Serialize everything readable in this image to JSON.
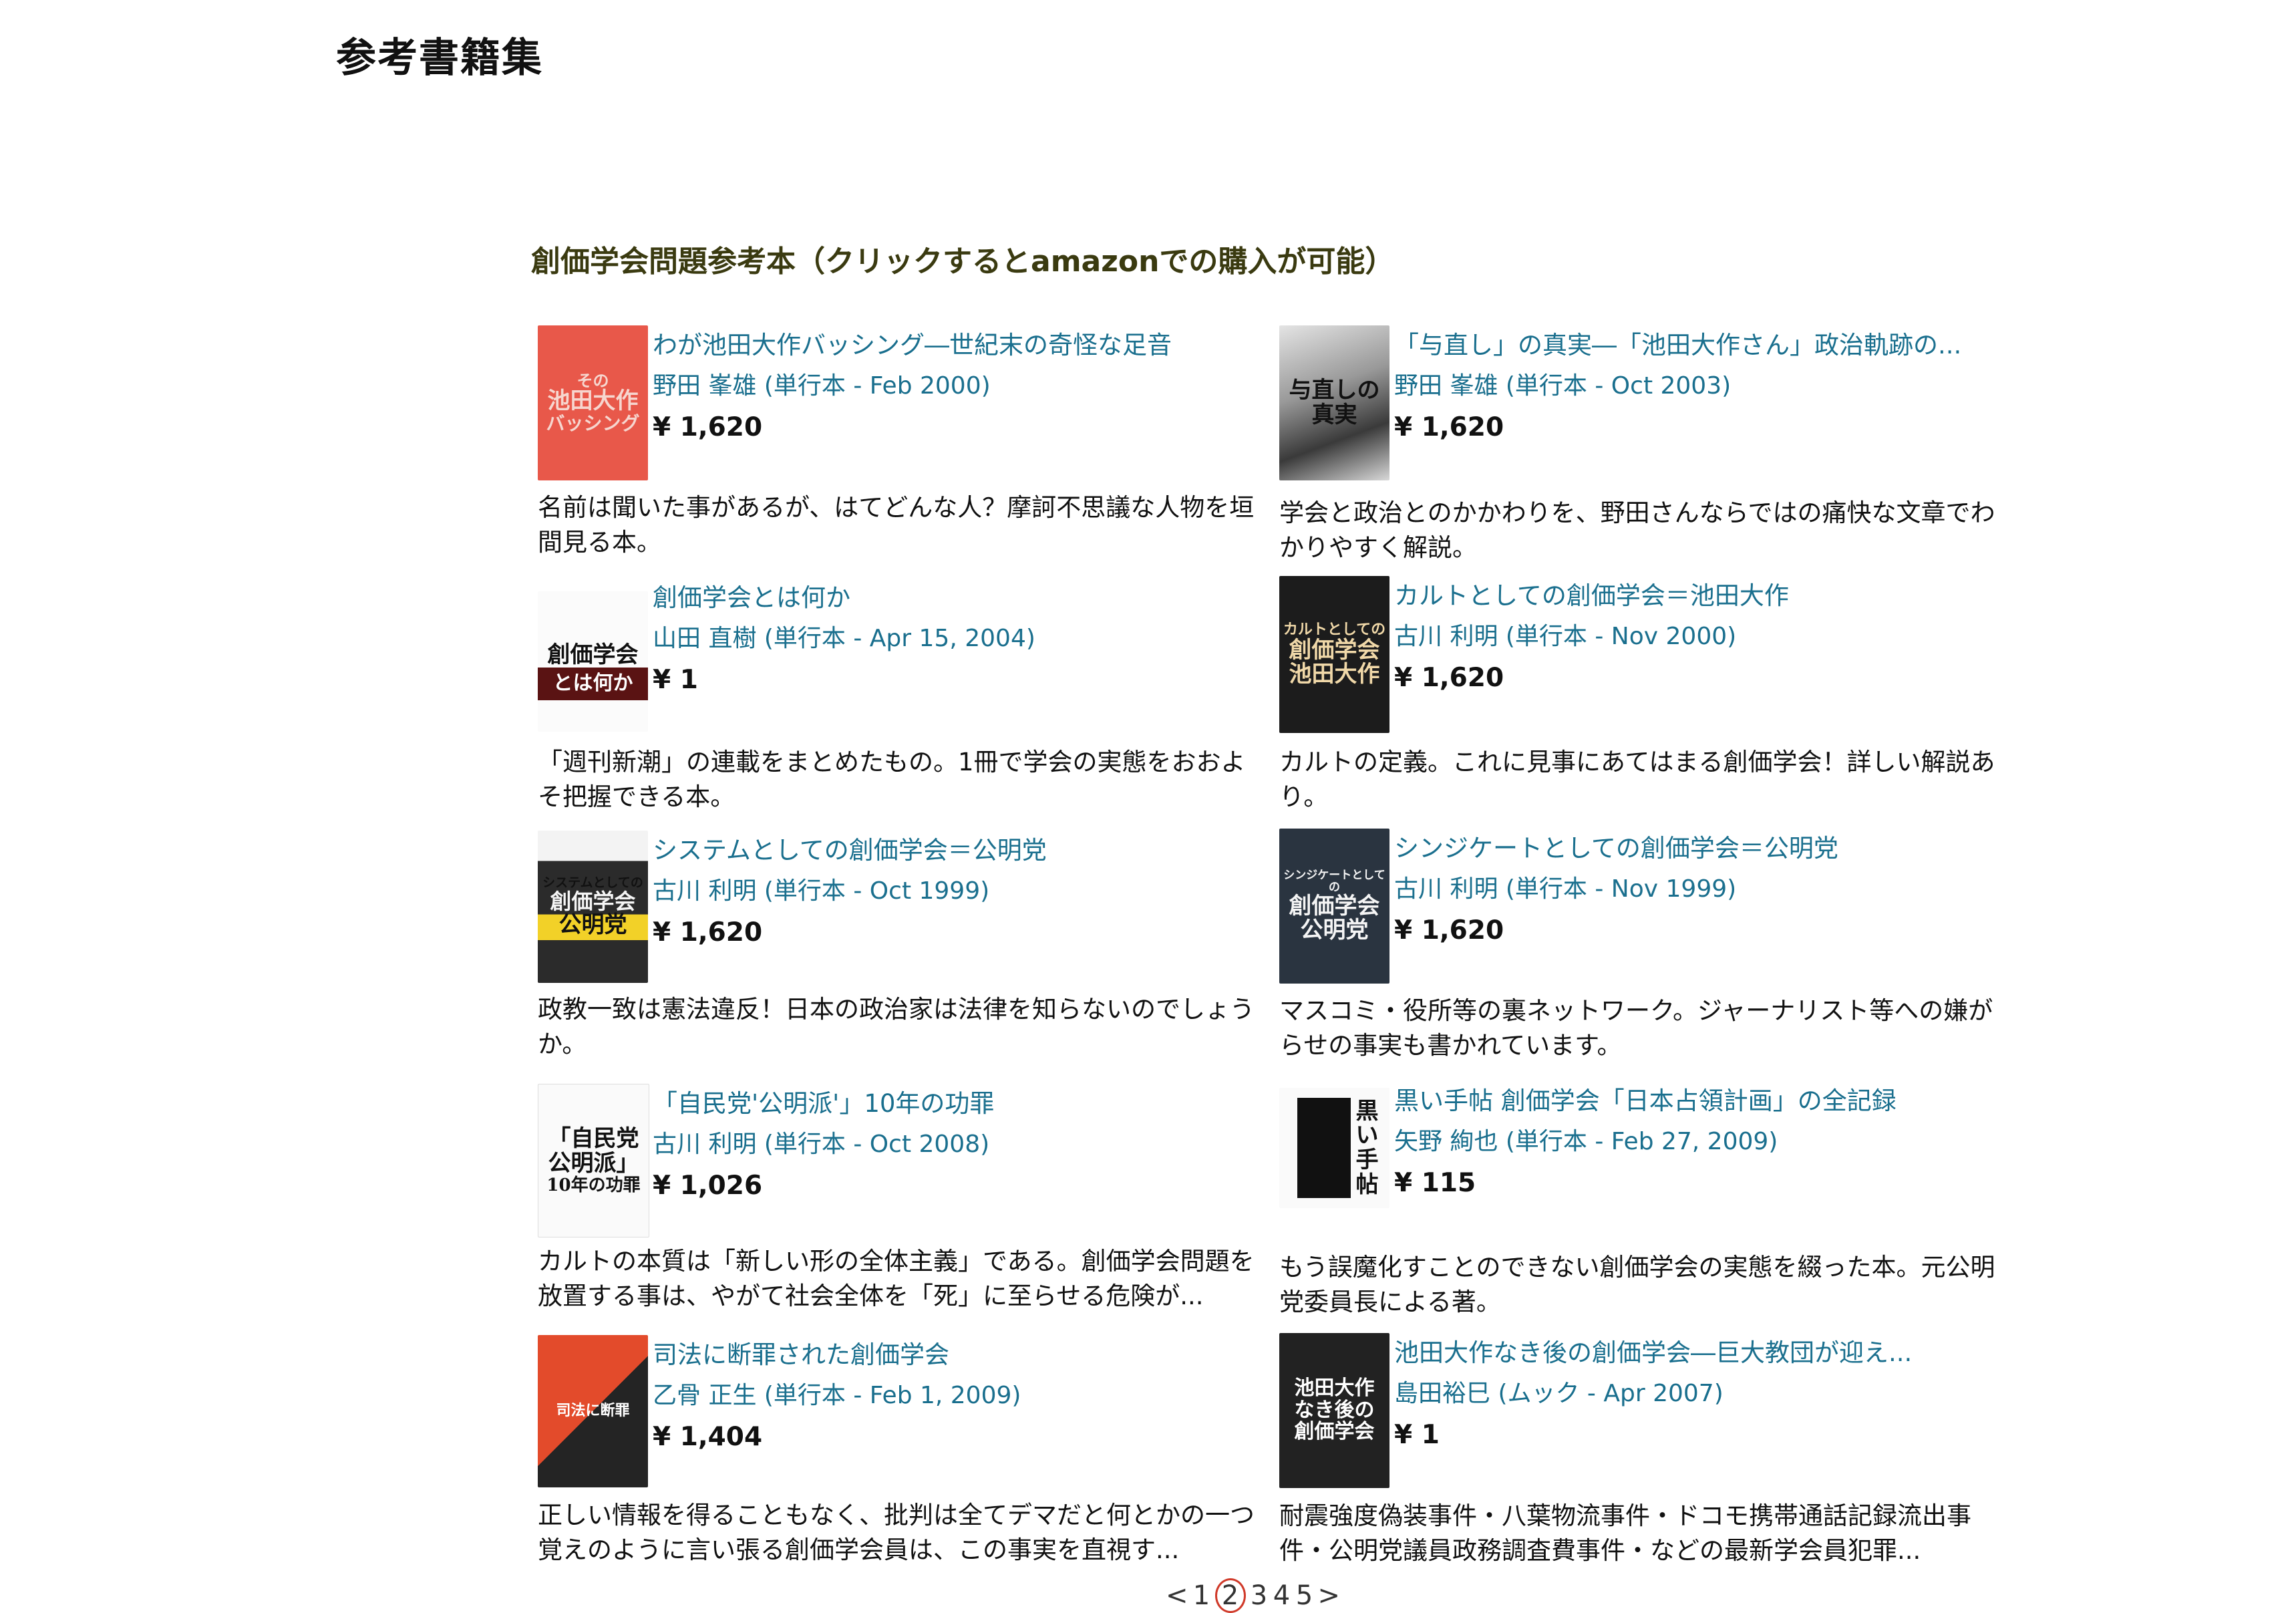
{
  "page_title": "参考書籍集",
  "section_heading": "創価学会問題参考本（クリックするとamazonでの購入が可能）",
  "books": [
    {
      "title": "わが池田大作バッシング―世紀末の奇怪な足音",
      "meta": "野田 峯雄 (単行本 - Feb 2000)",
      "price": "¥ 1,620",
      "description": "名前は聞いた事があるが、はてどんな人？摩訶不思議な人物を垣間見る本。"
    },
    {
      "title": "「与直し」の真実―「池田大作さん」政治軌跡の...",
      "meta": "野田 峯雄 (単行本 - Oct 2003)",
      "price": "¥ 1,620",
      "description": "学会と政治とのかかわりを、野田さんならではの痛快な文章でわかりやすく解説。"
    },
    {
      "title": "創価学会とは何か",
      "meta": "山田 直樹 (単行本 - Apr 15, 2004)",
      "price": "¥ 1",
      "description": "「週刊新潮」の連載をまとめたもの。1冊で学会の実態をおおよそ把握できる本。"
    },
    {
      "title": "カルトとしての創価学会＝池田大作",
      "meta": "古川 利明 (単行本 - Nov 2000)",
      "price": "¥ 1,620",
      "description": "カルトの定義。これに見事にあてはまる創価学会！詳しい解説あり。"
    },
    {
      "title": "システムとしての創価学会＝公明党",
      "meta": "古川 利明 (単行本 - Oct 1999)",
      "price": "¥ 1,620",
      "description": "政教一致は憲法違反！日本の政治家は法律を知らないのでしょうか。"
    },
    {
      "title": "シンジケートとしての創価学会＝公明党",
      "meta": "古川 利明 (単行本 - Nov 1999)",
      "price": "¥ 1,620",
      "description": "マスコミ・役所等の裏ネットワーク。ジャーナリスト等への嫌がらせの事実も書かれています。"
    },
    {
      "title": "「自民党'公明派'」10年の功罪",
      "meta": "古川 利明 (単行本 - Oct 2008)",
      "price": "¥ 1,026",
      "description": "カルトの本質は「新しい形の全体主義」である。創価学会問題を放置する事は、やがて社会全体を「死」に至らせる危険が..."
    },
    {
      "title": "黒い手帖 創価学会「日本占領計画」の全記録",
      "meta": "矢野 絢也 (単行本 - Feb 27, 2009)",
      "price": "¥ 115",
      "description": "もう誤魔化すことのできない創価学会の実態を綴った本。元公明党委員長による著。"
    },
    {
      "title": "司法に断罪された創価学会",
      "meta": "乙骨 正生 (単行本 - Feb 1, 2009)",
      "price": "¥ 1,404",
      "description": "正しい情報を得ることもなく、批判は全てデマだと何とかの一つ覚えのように言い張る創価学会員は、この事実を直視す..."
    },
    {
      "title": "池田大作なき後の創価学会―巨大教団が迎え...",
      "meta": "島田裕巳 (ムック - Apr 2007)",
      "price": "¥ 1",
      "description": "耐震強度偽装事件・八葉物流事件・ドコモ携帯通話記録流出事件・公明党議員政務調査費事件・などの最新学会員犯罪..."
    }
  ],
  "covers": [
    {
      "lines": [
        "その",
        "池田大作",
        "バッシング"
      ]
    },
    {
      "lines": [
        "与直しの",
        "真実"
      ]
    },
    {
      "lines": [
        "創価学会",
        "とは何か"
      ]
    },
    {
      "lines": [
        "カルトとしての",
        "創価学会",
        "池田大作"
      ]
    },
    {
      "lines": [
        "システムとしての",
        "創価学会",
        "公明党"
      ]
    },
    {
      "lines": [
        "シンジケートとしての",
        "創価学会",
        "公明党"
      ]
    },
    {
      "lines": [
        "「自民党",
        "公明派」",
        "10年の功罪"
      ]
    },
    {
      "lines": [
        "黒",
        "い",
        "手",
        "帖"
      ]
    },
    {
      "lines": [
        "司",
        "法",
        "に",
        "断",
        "罪"
      ]
    },
    {
      "lines": [
        "池田大作",
        "なき後の",
        "創価学会"
      ]
    }
  ],
  "pagination": {
    "prev": "<",
    "pages": [
      "1",
      "2",
      "3",
      "4",
      "5"
    ],
    "current": "2",
    "next": ">"
  }
}
